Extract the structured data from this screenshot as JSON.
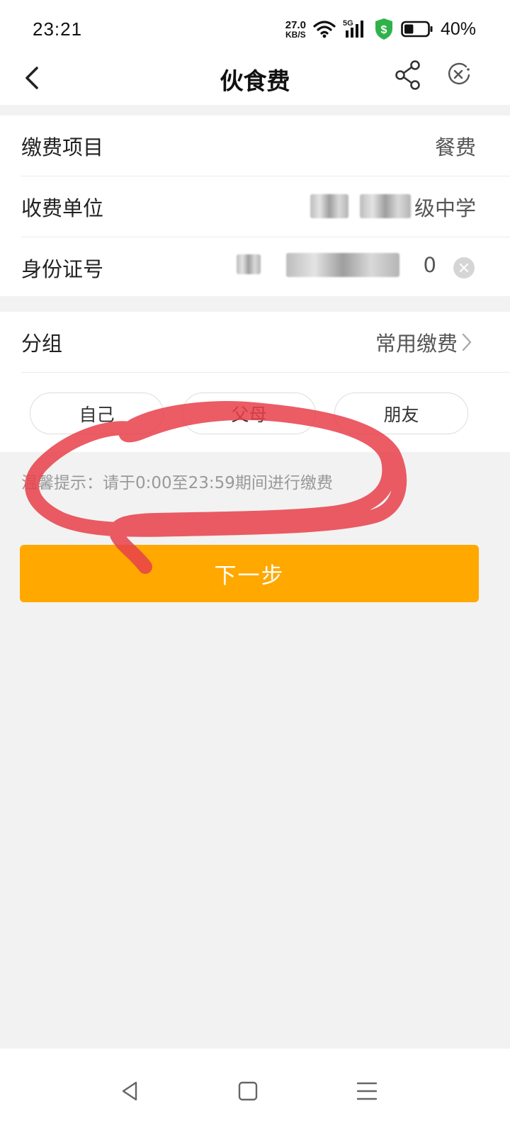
{
  "status_bar": {
    "time": "23:21",
    "net_speed_value": "27.0",
    "net_speed_unit": "KB/S",
    "network": "5G",
    "battery_percent": "40%",
    "battery_level": 0.4
  },
  "nav": {
    "title": "伙食费"
  },
  "form": {
    "item_label": "缴费项目",
    "item_value": "餐费",
    "payee_label": "收费单位",
    "payee_value_visible": "级中学",
    "id_label": "身份证号",
    "id_value_visible": "0"
  },
  "group": {
    "label": "分组",
    "value": "常用缴费",
    "chips": [
      "自己",
      "父母",
      "朋友"
    ]
  },
  "tip": "温馨提示：请于0:00至23:59期间进行缴费",
  "next_button": "下一步",
  "colors": {
    "accent": "#ffa800",
    "annotation": "#e8404a"
  }
}
